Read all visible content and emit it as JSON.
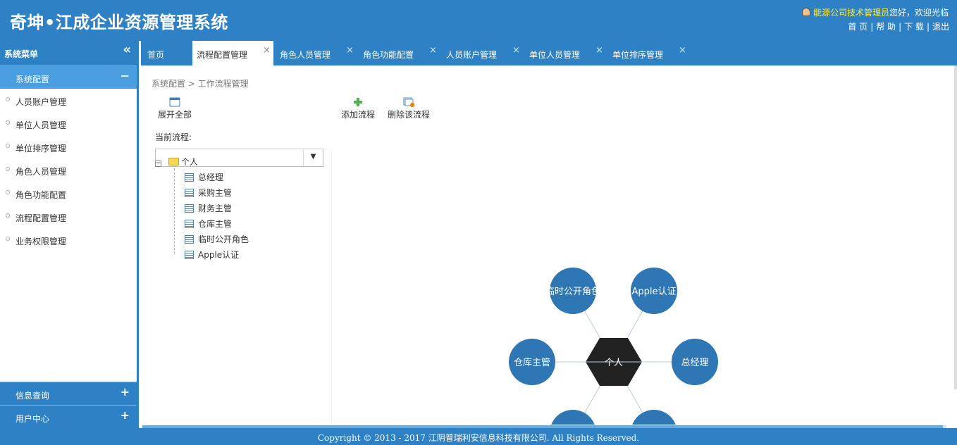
{
  "header": {
    "app_title": "奇坤•江成企业资源管理系统",
    "user_name": "能源公司技术管理员",
    "greeting": "您好，欢迎光临",
    "links": [
      "首 页",
      "帮 助",
      "下 载",
      "退出"
    ]
  },
  "sidebar": {
    "title": "系统菜单",
    "sections": [
      {
        "label": "系统配置",
        "toggle": "−",
        "expanded": true,
        "items": [
          "人员账户管理",
          "单位人员管理",
          "单位排序管理",
          "角色人员管理",
          "角色功能配置",
          "流程配置管理",
          "业务权限管理"
        ]
      },
      {
        "label": "信息查询",
        "toggle": "+",
        "expanded": false
      },
      {
        "label": "用户中心",
        "toggle": "+",
        "expanded": false
      }
    ]
  },
  "tabs": [
    {
      "label": "首页",
      "closable": false,
      "active": false
    },
    {
      "label": "流程配置管理",
      "closable": true,
      "active": true
    },
    {
      "label": "角色人员管理",
      "closable": true,
      "active": false
    },
    {
      "label": "角色功能配置",
      "closable": true,
      "active": false
    },
    {
      "label": "人员账户管理",
      "closable": true,
      "active": false
    },
    {
      "label": "单位人员管理",
      "closable": true,
      "active": false
    },
    {
      "label": "单位排序管理",
      "closable": true,
      "active": false
    }
  ],
  "breadcrumb": "系统配置 > 工作流程管理",
  "toolbar": {
    "expand_all": "展开全部",
    "add_flow": "添加流程",
    "delete_flow": "删除该流程"
  },
  "current_flow_label": "当前流程:",
  "flow_select_value": "",
  "tree": {
    "root": "个人",
    "children": [
      "总经理",
      "采购主管",
      "财务主管",
      "仓库主管",
      "临时公开角色",
      "Apple认证"
    ]
  },
  "diagram": {
    "center": "个人",
    "nodes": [
      "临时公开角色",
      "Apple认证",
      "仓库主管",
      "总经理",
      "",
      ""
    ]
  },
  "footer": "Copyright © 2013 - 2017 江阴普瑞利安信息科技有限公司. All Rights Reserved.",
  "colors": {
    "primary": "#2e81c4",
    "node": "#2f76b5",
    "center": "#222222"
  }
}
